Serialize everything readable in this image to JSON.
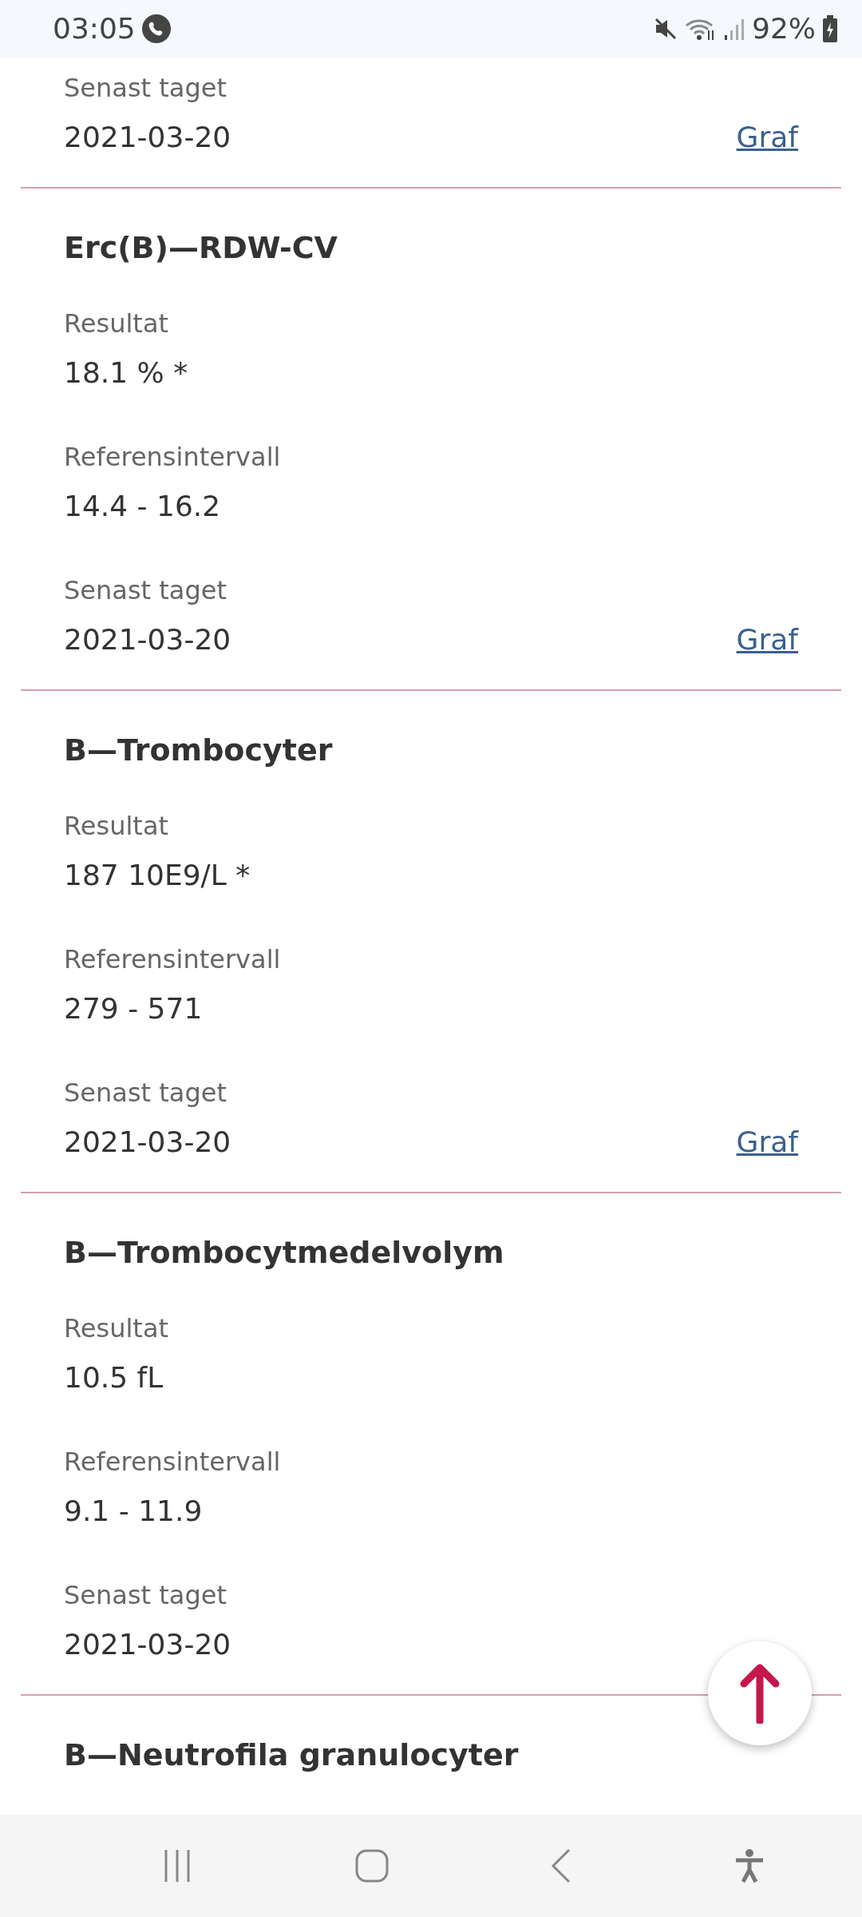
{
  "status_bar": {
    "time": "03:05",
    "battery": "92%"
  },
  "cards": [
    {
      "fields": [
        {
          "label": "Senast taget",
          "value": "2021-03-20"
        }
      ],
      "link": "Graf"
    },
    {
      "title": "Erc(B)—RDW-CV",
      "fields": [
        {
          "label": "Resultat",
          "value": "18.1 % *"
        },
        {
          "label": "Referensintervall",
          "value": "14.4 - 16.2"
        },
        {
          "label": "Senast taget",
          "value": "2021-03-20"
        }
      ],
      "link": "Graf"
    },
    {
      "title": "B—Trombocyter",
      "fields": [
        {
          "label": "Resultat",
          "value": "187 10E9/L *"
        },
        {
          "label": "Referensintervall",
          "value": "279 - 571"
        },
        {
          "label": "Senast taget",
          "value": "2021-03-20"
        }
      ],
      "link": "Graf"
    },
    {
      "title": "B—Trombocytmedelvolym",
      "fields": [
        {
          "label": "Resultat",
          "value": "10.5 fL"
        },
        {
          "label": "Referensintervall",
          "value": "9.1 - 11.9"
        },
        {
          "label": "Senast taget",
          "value": "2021-03-20"
        }
      ]
    },
    {
      "title": "B—Neutrofila granulocyter"
    }
  ]
}
